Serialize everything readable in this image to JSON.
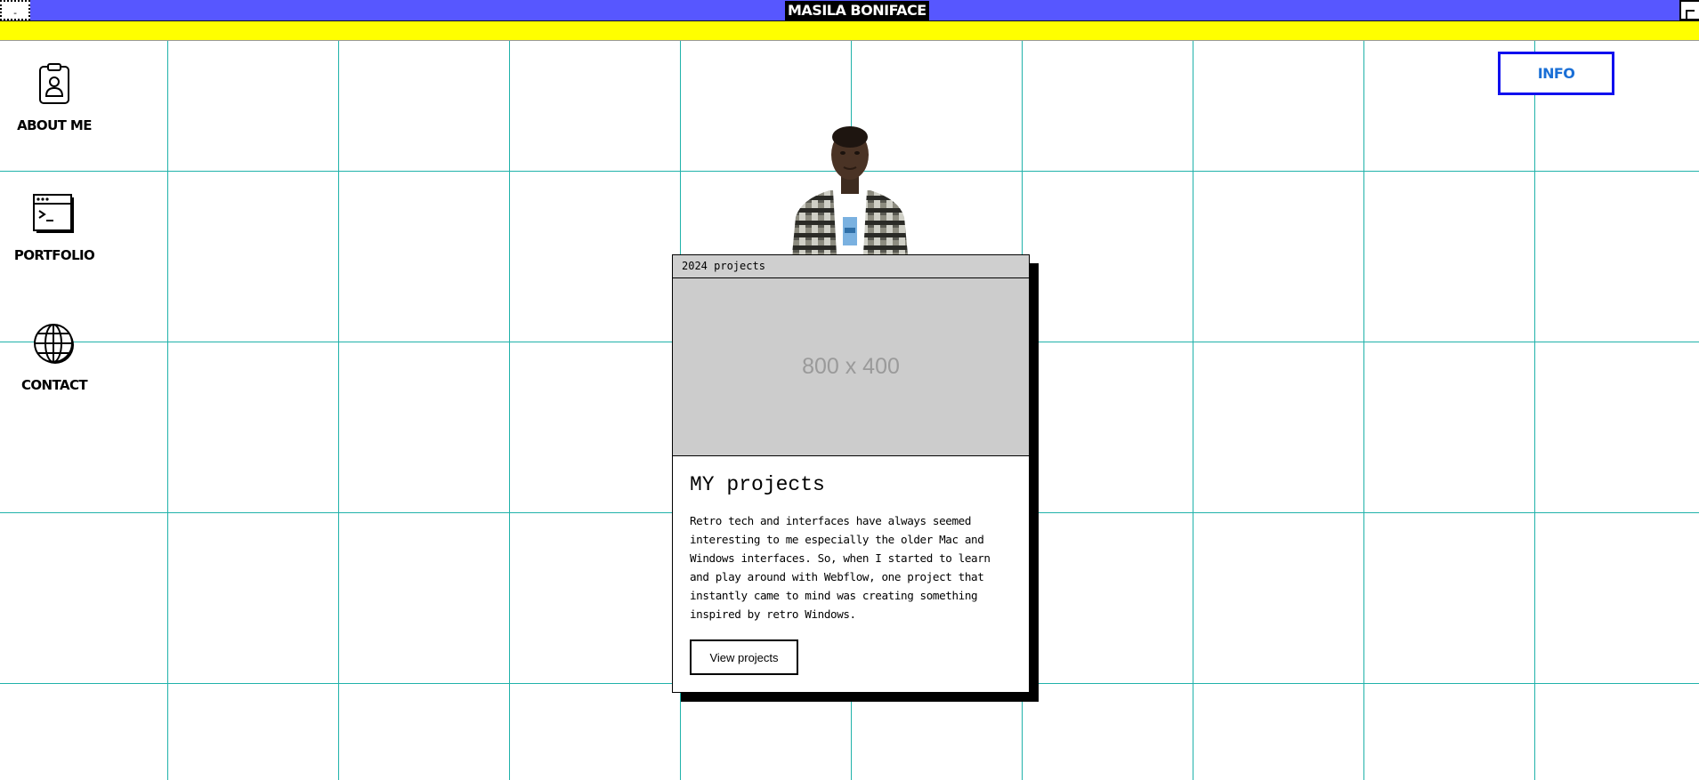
{
  "titlebar": {
    "title": "MASILA BONIFACE",
    "left_button_glyph": "-",
    "color": "#5757ff"
  },
  "desktop": {
    "grid_color": "#20b2aa",
    "background": "#ffffff",
    "yellow_bar_color": "#ffff00",
    "icons": [
      {
        "icon": "id-badge-icon",
        "label": "ABOUT ME"
      },
      {
        "icon": "terminal-window-icon",
        "label": "PORTFOLIO"
      },
      {
        "icon": "globe-icon",
        "label": "CONTACT"
      }
    ],
    "info_button": {
      "label": "INFO",
      "border_color": "#1010ee",
      "text_color": "#1a6fd6"
    }
  },
  "window": {
    "header": "2024 projects",
    "image_placeholder": "800 x 400",
    "heading": "MY projects",
    "body": "Retro tech and interfaces have always seemed interesting to me especially the older Mac and Windows interfaces. So, when I started to learn and play around with Webflow, one project that instantly came to mind was creating something inspired by retro Windows.",
    "button_label": "View projects"
  }
}
